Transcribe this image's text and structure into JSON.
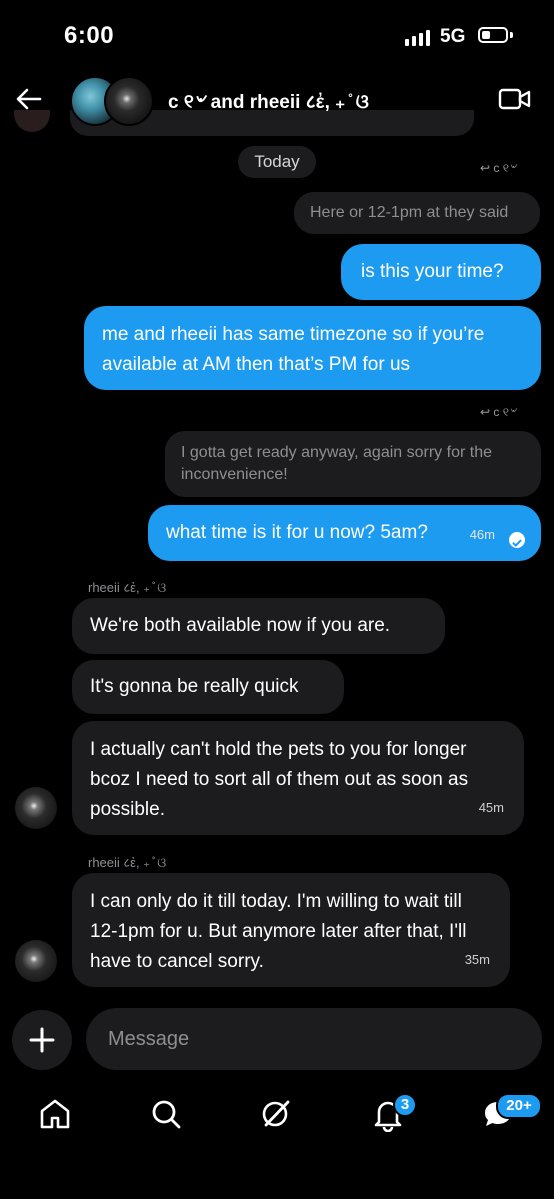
{
  "status_bar": {
    "time": "6:00",
    "network": "5G"
  },
  "header": {
    "title": "c ୧৺ and rheeii ८ἐ, ₊ ̊ ଓ",
    "avatars": [
      "profile-photo",
      "profile-photo"
    ]
  },
  "chat": {
    "date_chip": "Today",
    "reply_tag_1": "c ୧৺",
    "quoted_1": "Here or 12-1pm at they said",
    "out_1": "is this your time?",
    "out_2": "me and rheeii has same timezone so if you’re available at AM then that’s PM for us",
    "reply_tag_2": "c ୧৺",
    "quoted_2": "I gotta get ready anyway, again sorry for the inconvenience!",
    "out_3": "what time is it for u now? 5am?",
    "out_3_time": "46m",
    "sender_1": "rheeii ८ἐ, ₊ ̊ ଓ",
    "in_1": "We're both available now if you are.",
    "in_2": "It's gonna be really quick",
    "in_3": "I actually can't hold the pets to you for longer bcoz I need to sort all of them out as soon as possible.",
    "in_3_time": "45m",
    "sender_2": "rheeii ८ἐ, ₊ ̊ ଓ",
    "in_4": "I can only do it till today. I'm willing to wait till 12-1pm for u. But anymore later after that, I'll have to cancel sorry.",
    "in_4_time": "35m"
  },
  "composer": {
    "placeholder": "Message"
  },
  "bottom_nav": {
    "items": [
      "home-icon",
      "search-icon",
      "grok-icon",
      "notifications-icon",
      "messages-icon"
    ],
    "notifications_badge": "3",
    "messages_badge": "20+"
  },
  "colors": {
    "accent": "#1d9bf0",
    "bubble_dark": "#1c1c1e",
    "background": "#000000"
  }
}
